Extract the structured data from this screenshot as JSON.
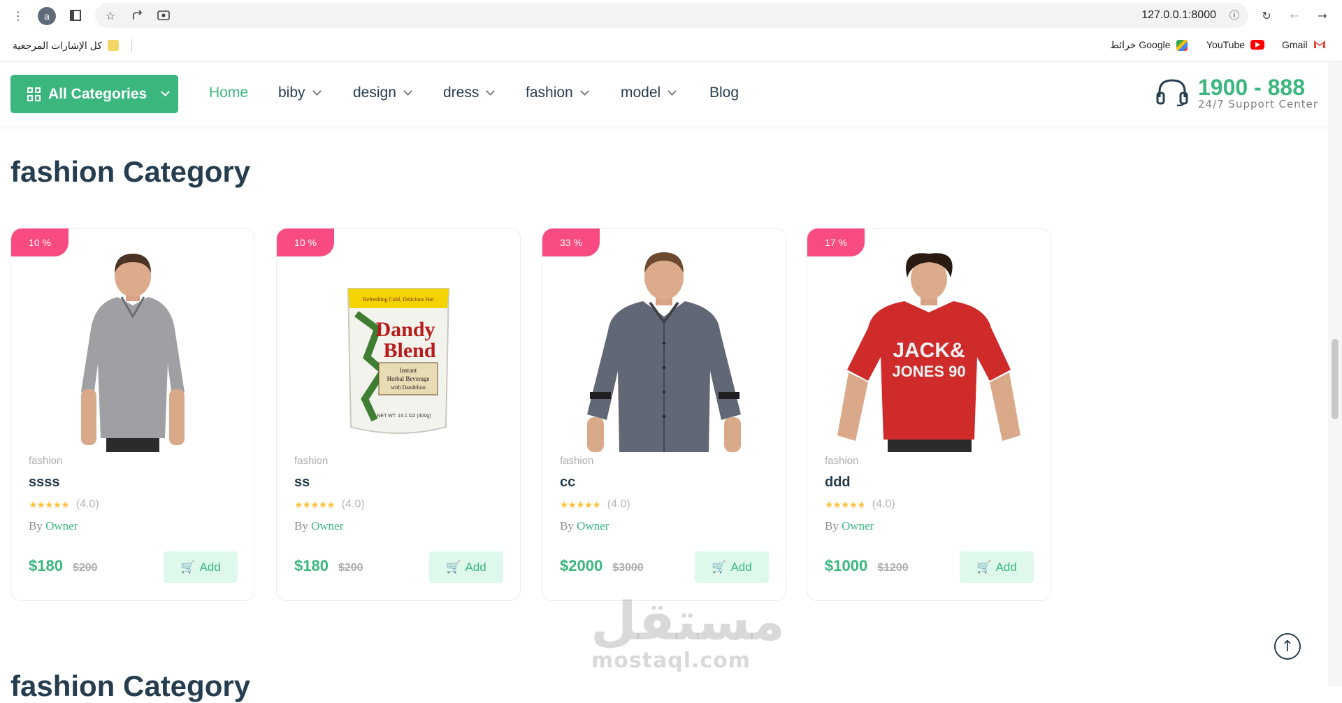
{
  "browser": {
    "profile_initial": "a",
    "url": "127.0.0.1:8000",
    "bookmarks_folder": "كل الإشارات المرجعية",
    "bookmarks": [
      {
        "label": "Gmail",
        "icon": "gmail-icon"
      },
      {
        "label": "YouTube",
        "icon": "youtube-icon"
      },
      {
        "label": "خرائط Google",
        "icon": "maps-icon"
      }
    ]
  },
  "header": {
    "all_categories": "All Categories",
    "nav": [
      {
        "label": "Home",
        "active": true
      },
      {
        "label": "biby",
        "dropdown": true
      },
      {
        "label": "design",
        "dropdown": true
      },
      {
        "label": "dress",
        "dropdown": true
      },
      {
        "label": "fashion",
        "dropdown": true
      },
      {
        "label": "model",
        "dropdown": true
      },
      {
        "label": "Blog"
      }
    ],
    "phone": "1900 - 888",
    "support": "24/7 Support Center"
  },
  "sections": [
    {
      "title": "fashion Category"
    },
    {
      "title": "fashion Category"
    }
  ],
  "products": [
    {
      "badge": "10 %",
      "category": "fashion",
      "name": "ssss",
      "rating": "(4.0)",
      "by": "By",
      "owner": "Owner",
      "price": "$180",
      "old_price": "$200",
      "add": "Add",
      "image": "grey-polo-shirt"
    },
    {
      "badge": "10 %",
      "category": "fashion",
      "name": "ss",
      "rating": "(4.0)",
      "by": "By",
      "owner": "Owner",
      "price": "$180",
      "old_price": "$200",
      "add": "Add",
      "image": "herbal-beverage-pouch"
    },
    {
      "badge": "33 %",
      "category": "fashion",
      "name": "cc",
      "rating": "(4.0)",
      "by": "By",
      "owner": "Owner",
      "price": "$2000",
      "old_price": "$3000",
      "add": "Add",
      "image": "grey-button-shirt"
    },
    {
      "badge": "17 %",
      "category": "fashion",
      "name": "ddd",
      "rating": "(4.0)",
      "by": "By",
      "owner": "Owner",
      "price": "$1000",
      "old_price": "$1200",
      "add": "Add",
      "image": "red-tshirt"
    }
  ],
  "pouch": {
    "top": "Refreshing Cold, Delicious Hot",
    "brand1": "Dandy",
    "brand2": "Blend",
    "line1": "Instant",
    "line2": "Herbal Beverage",
    "line3": "with Dandelion",
    "net": "NET WT. 14.1 OZ (400g)"
  },
  "tshirt_print": {
    "line1": "JACK&",
    "line2": "JONES 90"
  },
  "watermark": {
    "arabic": "مستقل",
    "latin": "mostaql.com"
  },
  "colors": {
    "brand": "#3bb77e",
    "badge": "#f74b81",
    "text": "#253d4e",
    "add_bg": "#def9ec"
  }
}
